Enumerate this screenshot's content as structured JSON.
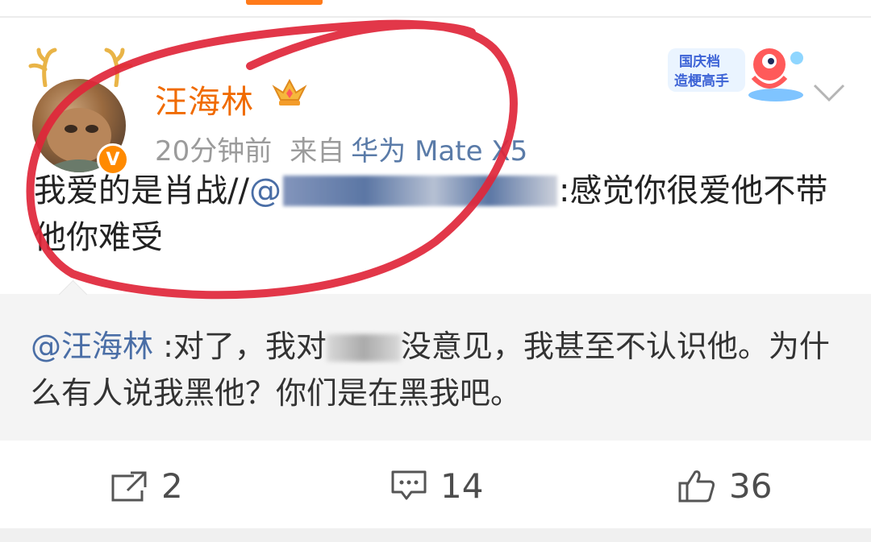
{
  "post": {
    "username": "汪海林",
    "time": "20分钟前",
    "source_prefix": "来自",
    "device": "华为 Mate X5",
    "verified_mark": "V",
    "text_before": "我爱的是肖战//",
    "mention_at": "@",
    "mention_visible_tail": "",
    "text_after": ":感觉你很爱他不带他你难受"
  },
  "badge": {
    "line1": "国庆档",
    "line2": "造梗高手"
  },
  "retweet": {
    "mention": "@汪海林",
    "text_part1": " :对了，我对",
    "text_part2": "没意见，我甚至不认识他。为什么有人说我黑他？你们是在黑我吧。"
  },
  "actions": {
    "share_count": "2",
    "comment_count": "14",
    "like_count": "36"
  },
  "colors": {
    "username": "#f06b00",
    "link": "#4a6ea6",
    "annotation": "#e0263a",
    "retweet_bg": "#f4f4f4"
  }
}
